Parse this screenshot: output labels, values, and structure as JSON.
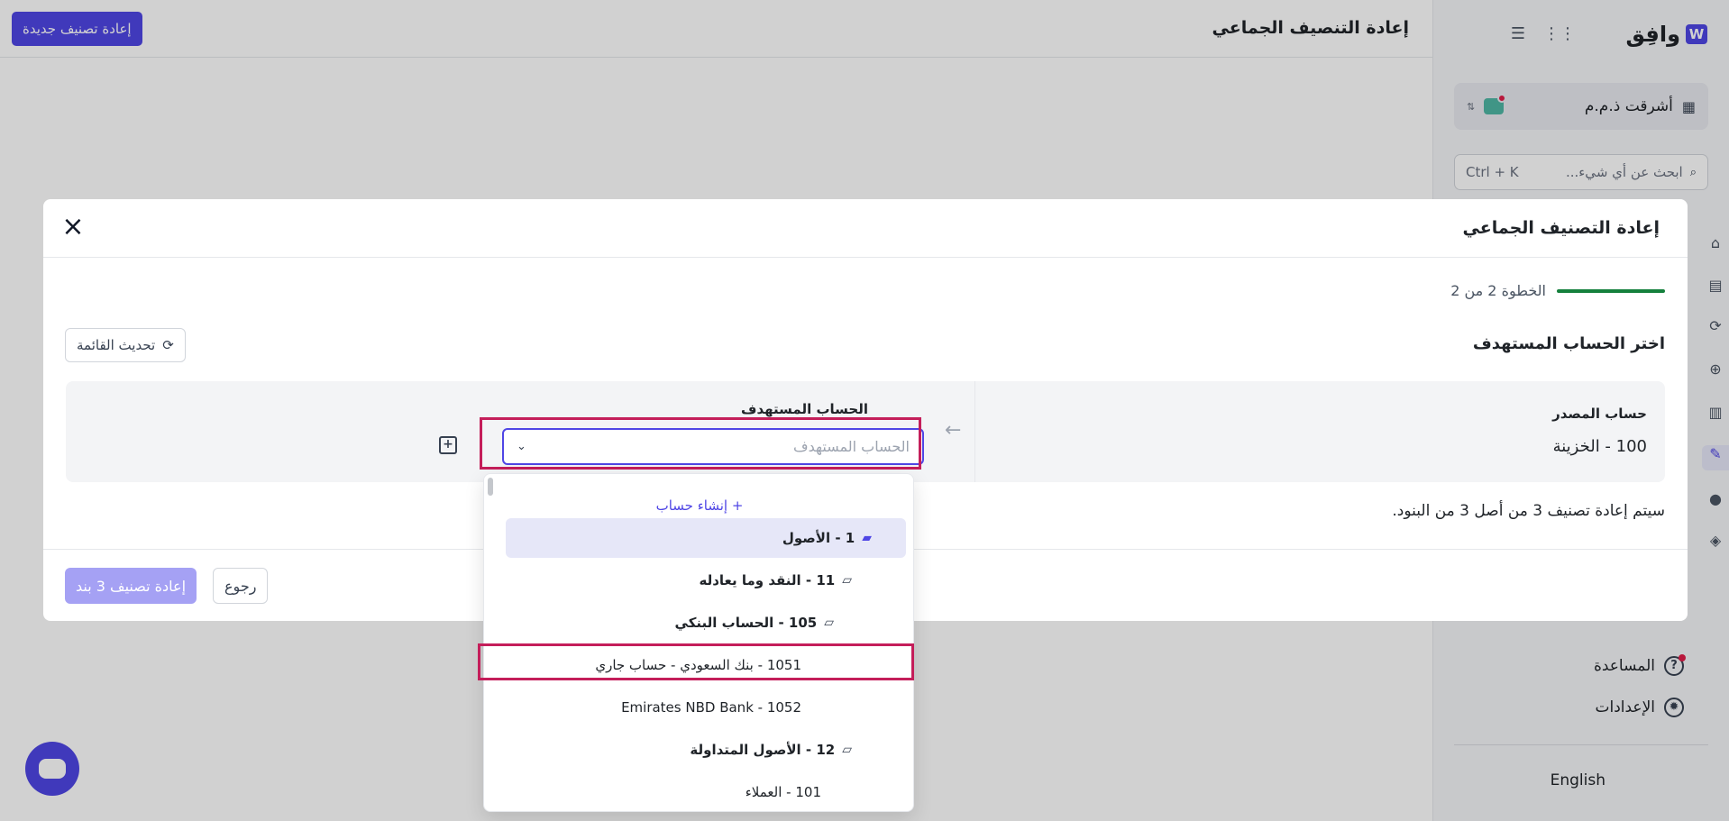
{
  "app": {
    "brand_name": "وافِق",
    "page_title": "إعادة التنصيف الجماعي",
    "new_button": "إعادة تصنيف جديدة"
  },
  "sidebar": {
    "org_name": "أشرقت ذ.م.م",
    "search_placeholder": "ابحث عن أي شيء...",
    "search_shortcut": "Ctrl + K",
    "help_label": "المساعدة",
    "settings_label": "الإعدادات",
    "language": "English"
  },
  "modal": {
    "title": "إعادة التصنيف الجماعي",
    "step_text": "الخطوة 2 من 2",
    "step_progress_percent": 100,
    "section_title": "اختر الحساب المستهدف",
    "refresh_label": "تحديث القائمة",
    "source_label": "حساب المصدر",
    "source_value": "100 - الخزينة",
    "target_label": "الحساب المستهدف",
    "target_placeholder": "الحساب المستهدف",
    "info_text": "سيتم إعادة تصنيف 3 من أصل 3 من البنود.",
    "back_label": "رجوع",
    "confirm_label": "إعادة تصنيف 3 بند"
  },
  "dropdown": {
    "create_label": "+ إنشاء حساب",
    "items": [
      {
        "label": "1 - الأصول",
        "folder": true,
        "selected": true
      },
      {
        "label": "11 - النقد وما يعادله",
        "folder": true
      },
      {
        "label": "105 - الحساب البنكي",
        "folder": true
      },
      {
        "label": "1051 - بنك السعودي - حساب جاري",
        "folder": false
      },
      {
        "label": "Emirates NBD Bank - 1052",
        "folder": false
      },
      {
        "label": "12 - الأصول المتداولة",
        "folder": true
      },
      {
        "label": "101 - العملاء",
        "folder": false
      }
    ]
  },
  "colors": {
    "accent": "#4f46e5",
    "highlight": "#c41e5a",
    "progress": "#15803d"
  }
}
